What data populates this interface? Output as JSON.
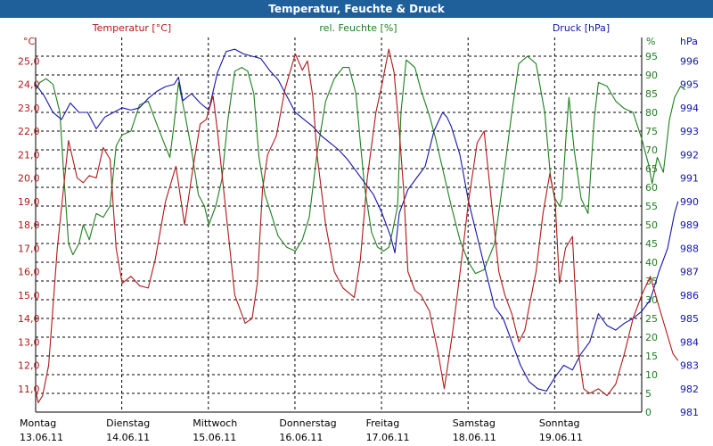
{
  "window": {
    "title": "Temperatur, Feuchte & Druck"
  },
  "colors": {
    "temp": "#b01818",
    "humid": "#1e7e1e",
    "press": "#1414a8",
    "grid": "#000000",
    "title_bg": "#1f5f9a"
  },
  "chart_data": {
    "type": "line",
    "series_labels": {
      "temp": "Temperatur [°C]",
      "humid": "rel. Feuchte [%]",
      "press": "Druck [hPa]"
    },
    "axis_units": {
      "left": "°C",
      "right1": "%",
      "right2": "hPa"
    },
    "left_axis": {
      "min": 10,
      "max": 26,
      "ticks": [
        "11,0",
        "12,0",
        "13,0",
        "14,0",
        "15,0",
        "16,0",
        "17,0",
        "18,0",
        "19,0",
        "20,0",
        "21,0",
        "22,0",
        "23,0",
        "24,0",
        "25,0"
      ]
    },
    "humid_axis": {
      "min": 0,
      "max": 100,
      "ticks": [
        "0",
        "5",
        "10",
        "15",
        "20",
        "25",
        "30",
        "35",
        "40",
        "45",
        "50",
        "55",
        "60",
        "65",
        "70",
        "75",
        "80",
        "85",
        "90",
        "95"
      ]
    },
    "press_axis": {
      "min": 981,
      "max": 997,
      "ticks": [
        "981",
        "982",
        "983",
        "984",
        "985",
        "986",
        "987",
        "988",
        "989",
        "990",
        "991",
        "992",
        "993",
        "994",
        "995",
        "996"
      ]
    },
    "x_range": [
      0,
      7
    ],
    "days": [
      {
        "name": "Montag",
        "date": "13.06.11"
      },
      {
        "name": "Dienstag",
        "date": "14.06.11"
      },
      {
        "name": "Mittwoch",
        "date": "15.06.11"
      },
      {
        "name": "Donnerstag",
        "date": "16.06.11"
      },
      {
        "name": "Freitag",
        "date": "17.06.11"
      },
      {
        "name": "Samstag",
        "date": "18.06.11"
      },
      {
        "name": "Sonntag",
        "date": "19.06.11"
      }
    ],
    "series": {
      "temp": [
        [
          0,
          10.9
        ],
        [
          0.03,
          10.4
        ],
        [
          0.08,
          10.7
        ],
        [
          0.15,
          12
        ],
        [
          0.25,
          17
        ],
        [
          0.38,
          21.6
        ],
        [
          0.48,
          20
        ],
        [
          0.55,
          19.8
        ],
        [
          0.62,
          20.1
        ],
        [
          0.7,
          20
        ],
        [
          0.78,
          21.3
        ],
        [
          0.86,
          20.8
        ],
        [
          0.93,
          17
        ],
        [
          1,
          15.5
        ],
        [
          1.1,
          15.8
        ],
        [
          1.2,
          15.4
        ],
        [
          1.3,
          15.3
        ],
        [
          1.38,
          16.5
        ],
        [
          1.5,
          19
        ],
        [
          1.62,
          20.5
        ],
        [
          1.72,
          18
        ],
        [
          1.82,
          20.5
        ],
        [
          1.9,
          22.3
        ],
        [
          1.97,
          22.5
        ],
        [
          2.05,
          23.5
        ],
        [
          2.1,
          22
        ],
        [
          2.2,
          18.5
        ],
        [
          2.3,
          15
        ],
        [
          2.42,
          13.8
        ],
        [
          2.5,
          14
        ],
        [
          2.56,
          15.5
        ],
        [
          2.62,
          19.5
        ],
        [
          2.68,
          21
        ],
        [
          2.78,
          21.8
        ],
        [
          2.88,
          23.8
        ],
        [
          3,
          25.3
        ],
        [
          3.08,
          24.6
        ],
        [
          3.14,
          25
        ],
        [
          3.2,
          23.5
        ],
        [
          3.25,
          21
        ],
        [
          3.35,
          18
        ],
        [
          3.45,
          16
        ],
        [
          3.55,
          15.3
        ],
        [
          3.68,
          14.9
        ],
        [
          3.75,
          16.5
        ],
        [
          3.83,
          20
        ],
        [
          3.93,
          22.8
        ],
        [
          4,
          24
        ],
        [
          4.08,
          25.5
        ],
        [
          4.14,
          24.5
        ],
        [
          4.2,
          22
        ],
        [
          4.25,
          19.5
        ],
        [
          4.3,
          16
        ],
        [
          4.38,
          15.2
        ],
        [
          4.45,
          15
        ],
        [
          4.55,
          14.3
        ],
        [
          4.65,
          12.5
        ],
        [
          4.72,
          11
        ],
        [
          4.82,
          13.5
        ],
        [
          4.92,
          16.5
        ],
        [
          5,
          19
        ],
        [
          5.1,
          21.5
        ],
        [
          5.18,
          22
        ],
        [
          5.25,
          19.5
        ],
        [
          5.35,
          16
        ],
        [
          5.42,
          15
        ],
        [
          5.5,
          14.2
        ],
        [
          5.58,
          13
        ],
        [
          5.65,
          13.5
        ],
        [
          5.7,
          14.5
        ],
        [
          5.78,
          16
        ],
        [
          5.86,
          18.5
        ],
        [
          5.94,
          20.2
        ],
        [
          6,
          19
        ],
        [
          6.05,
          15.5
        ],
        [
          6.12,
          17
        ],
        [
          6.2,
          17.5
        ],
        [
          6.27,
          12.5
        ],
        [
          6.33,
          11
        ],
        [
          6.4,
          10.8
        ],
        [
          6.5,
          11
        ],
        [
          6.6,
          10.7
        ],
        [
          6.7,
          11.2
        ],
        [
          6.8,
          12.5
        ],
        [
          6.9,
          14
        ],
        [
          7,
          15
        ],
        [
          7.1,
          15.8
        ],
        [
          7.2,
          14.5
        ],
        [
          7.28,
          13.5
        ],
        [
          7.36,
          12.5
        ],
        [
          7.42,
          12.2
        ]
      ],
      "humid": [
        [
          0,
          86
        ],
        [
          0.05,
          88
        ],
        [
          0.12,
          89
        ],
        [
          0.2,
          87.5
        ],
        [
          0.28,
          80
        ],
        [
          0.32,
          65
        ],
        [
          0.38,
          45
        ],
        [
          0.43,
          42
        ],
        [
          0.5,
          45
        ],
        [
          0.55,
          50
        ],
        [
          0.62,
          46
        ],
        [
          0.7,
          53
        ],
        [
          0.78,
          52
        ],
        [
          0.86,
          55
        ],
        [
          0.93,
          71
        ],
        [
          1,
          74
        ],
        [
          1.1,
          75
        ],
        [
          1.2,
          82
        ],
        [
          1.3,
          83
        ],
        [
          1.38,
          78
        ],
        [
          1.48,
          72
        ],
        [
          1.55,
          68
        ],
        [
          1.6,
          77
        ],
        [
          1.65,
          88
        ],
        [
          1.72,
          80
        ],
        [
          1.8,
          70
        ],
        [
          1.88,
          58
        ],
        [
          1.95,
          55
        ],
        [
          2,
          50
        ],
        [
          2.08,
          55
        ],
        [
          2.15,
          62
        ],
        [
          2.22,
          78
        ],
        [
          2.3,
          91
        ],
        [
          2.38,
          92
        ],
        [
          2.45,
          91
        ],
        [
          2.52,
          85
        ],
        [
          2.58,
          68
        ],
        [
          2.65,
          58
        ],
        [
          2.72,
          53
        ],
        [
          2.8,
          47
        ],
        [
          2.9,
          44
        ],
        [
          3,
          43
        ],
        [
          3.08,
          46
        ],
        [
          3.16,
          52
        ],
        [
          3.25,
          69
        ],
        [
          3.35,
          83
        ],
        [
          3.45,
          89
        ],
        [
          3.55,
          92
        ],
        [
          3.62,
          92
        ],
        [
          3.7,
          85
        ],
        [
          3.75,
          72
        ],
        [
          3.8,
          60
        ],
        [
          3.88,
          48
        ],
        [
          3.95,
          44
        ],
        [
          4.02,
          43
        ],
        [
          4.08,
          44
        ],
        [
          4.12,
          48
        ],
        [
          4.18,
          55
        ],
        [
          4.22,
          80
        ],
        [
          4.28,
          94
        ],
        [
          4.38,
          92
        ],
        [
          4.45,
          86
        ],
        [
          4.55,
          79
        ],
        [
          4.62,
          73
        ],
        [
          4.7,
          65
        ],
        [
          4.8,
          55
        ],
        [
          4.9,
          46
        ],
        [
          5,
          40
        ],
        [
          5.08,
          37
        ],
        [
          5.18,
          38
        ],
        [
          5.3,
          45
        ],
        [
          5.4,
          62
        ],
        [
          5.5,
          80
        ],
        [
          5.58,
          93
        ],
        [
          5.68,
          95
        ],
        [
          5.78,
          93
        ],
        [
          5.88,
          80
        ],
        [
          5.95,
          62
        ],
        [
          6,
          57
        ],
        [
          6.05,
          55
        ],
        [
          6.08,
          57
        ],
        [
          6.13,
          75
        ],
        [
          6.16,
          84
        ],
        [
          6.22,
          70
        ],
        [
          6.3,
          57
        ],
        [
          6.38,
          53
        ],
        [
          6.45,
          78
        ],
        [
          6.5,
          88
        ],
        [
          6.6,
          87
        ],
        [
          6.7,
          83
        ],
        [
          6.8,
          81
        ],
        [
          6.9,
          80
        ],
        [
          7,
          73
        ],
        [
          7.08,
          66
        ],
        [
          7.12,
          61
        ],
        [
          7.18,
          68
        ],
        [
          7.25,
          64
        ],
        [
          7.32,
          78
        ],
        [
          7.38,
          84
        ],
        [
          7.45,
          87
        ],
        [
          7.5,
          86
        ]
      ],
      "press": [
        [
          0,
          995
        ],
        [
          0.1,
          994.5
        ],
        [
          0.2,
          993.8
        ],
        [
          0.3,
          993.5
        ],
        [
          0.4,
          994.2
        ],
        [
          0.5,
          993.8
        ],
        [
          0.6,
          993.8
        ],
        [
          0.7,
          993.1
        ],
        [
          0.8,
          993.6
        ],
        [
          0.9,
          993.8
        ],
        [
          1,
          994
        ],
        [
          1.1,
          993.9
        ],
        [
          1.2,
          994
        ],
        [
          1.3,
          994.4
        ],
        [
          1.4,
          994.7
        ],
        [
          1.5,
          994.9
        ],
        [
          1.6,
          995
        ],
        [
          1.65,
          995.3
        ],
        [
          1.7,
          994.3
        ],
        [
          1.8,
          994.6
        ],
        [
          1.9,
          994.2
        ],
        [
          2,
          993.9
        ],
        [
          2.1,
          995.5
        ],
        [
          2.2,
          996.4
        ],
        [
          2.3,
          996.5
        ],
        [
          2.4,
          996.3
        ],
        [
          2.5,
          996.2
        ],
        [
          2.6,
          996.1
        ],
        [
          2.7,
          995.6
        ],
        [
          2.8,
          995.2
        ],
        [
          2.9,
          994.5
        ],
        [
          3,
          993.8
        ],
        [
          3.1,
          993.5
        ],
        [
          3.2,
          993.2
        ],
        [
          3.3,
          992.8
        ],
        [
          3.4,
          992.5
        ],
        [
          3.5,
          992.2
        ],
        [
          3.6,
          991.8
        ],
        [
          3.7,
          991.3
        ],
        [
          3.8,
          990.8
        ],
        [
          3.9,
          990.3
        ],
        [
          4,
          989.5
        ],
        [
          4.1,
          988.5
        ],
        [
          4.15,
          987.8
        ],
        [
          4.2,
          989.5
        ],
        [
          4.3,
          990.5
        ],
        [
          4.4,
          991
        ],
        [
          4.5,
          991.5
        ],
        [
          4.6,
          993
        ],
        [
          4.7,
          993.8
        ],
        [
          4.75,
          993.6
        ],
        [
          4.8,
          993.2
        ],
        [
          4.9,
          992
        ],
        [
          5,
          990
        ],
        [
          5.1,
          988.5
        ],
        [
          5.2,
          987
        ],
        [
          5.3,
          985.5
        ],
        [
          5.4,
          985
        ],
        [
          5.5,
          984
        ],
        [
          5.6,
          983
        ],
        [
          5.7,
          982.3
        ],
        [
          5.8,
          982
        ],
        [
          5.9,
          981.9
        ],
        [
          6,
          982.5
        ],
        [
          6.1,
          983
        ],
        [
          6.2,
          982.8
        ],
        [
          6.3,
          983.5
        ],
        [
          6.4,
          984
        ],
        [
          6.5,
          985.2
        ],
        [
          6.6,
          984.7
        ],
        [
          6.7,
          984.5
        ],
        [
          6.8,
          984.8
        ],
        [
          6.9,
          985
        ],
        [
          7,
          985.3
        ],
        [
          7.1,
          985.8
        ],
        [
          7.2,
          987
        ],
        [
          7.3,
          988
        ],
        [
          7.38,
          989.5
        ],
        [
          7.42,
          990
        ]
      ]
    }
  }
}
